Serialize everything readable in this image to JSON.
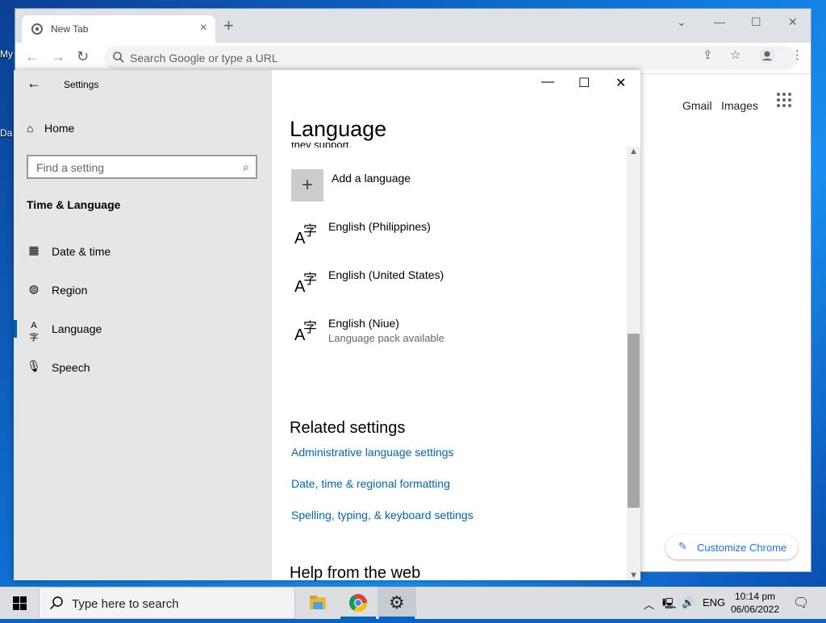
{
  "desktop": {
    "icon_labels": [
      "My",
      "Da"
    ]
  },
  "chrome": {
    "tab_title": "New Tab",
    "omnibox_placeholder": "Search Google or type a URL",
    "ntp_links": {
      "gmail": "Gmail",
      "images": "Images"
    },
    "customize_label": "Customize Chrome"
  },
  "settings": {
    "window_title": "Settings",
    "home_label": "Home",
    "search_placeholder": "Find a setting",
    "category_title": "Time & Language",
    "nav_items": [
      {
        "label": "Date & time",
        "icon": "calendar-clock-icon"
      },
      {
        "label": "Region",
        "icon": "globe-icon"
      },
      {
        "label": "Language",
        "icon": "language-icon",
        "selected": true
      },
      {
        "label": "Speech",
        "icon": "microphone-icon"
      }
    ],
    "page_title": "Language",
    "clipped_text": "they support.",
    "add_language_label": "Add a language",
    "languages": [
      {
        "name": "English (Philippines)",
        "sub": ""
      },
      {
        "name": "English (United States)",
        "sub": ""
      },
      {
        "name": "English (Niue)",
        "sub": "Language pack available"
      }
    ],
    "related_title": "Related settings",
    "related_links": [
      "Administrative language settings",
      "Date, time & regional formatting",
      "Spelling, typing, & keyboard settings"
    ],
    "help_title": "Help from the web"
  },
  "taskbar": {
    "search_placeholder": "Type here to search",
    "tray_language": "ENG",
    "clock_time": "10:14 pm",
    "clock_date": "06/06/2022"
  }
}
